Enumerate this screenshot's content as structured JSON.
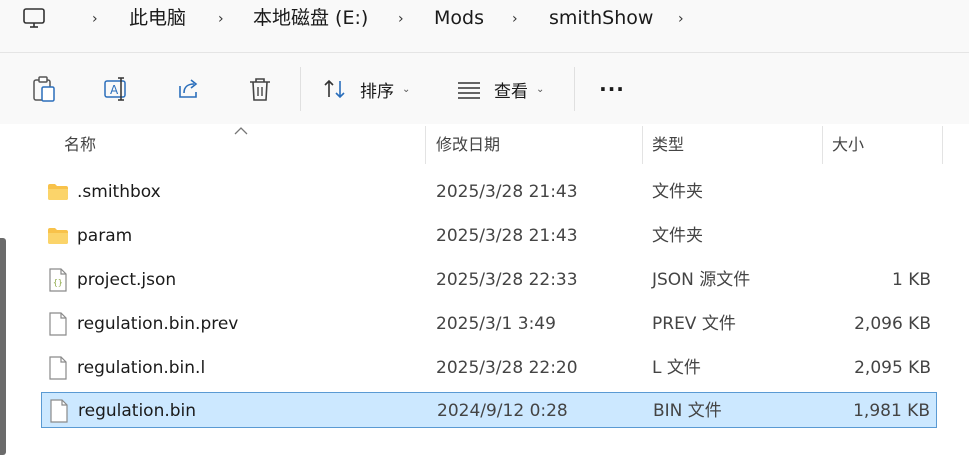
{
  "address": {
    "crumbs": [
      "此电脑",
      "本地磁盘 (E:)",
      "Mods",
      "smithShow"
    ],
    "chevron": "›"
  },
  "toolbar": {
    "sort_label": "排序",
    "view_label": "查看",
    "more_label": "···",
    "caret": "⌄"
  },
  "columns": {
    "name": "名称",
    "date": "修改日期",
    "type": "类型",
    "size": "大小"
  },
  "files": [
    {
      "name": ".smithbox",
      "date": "2025/3/28 21:43",
      "type": "文件夹",
      "size": "",
      "icon": "folder-icon"
    },
    {
      "name": "param",
      "date": "2025/3/28 21:43",
      "type": "文件夹",
      "size": "",
      "icon": "folder-icon"
    },
    {
      "name": "project.json",
      "date": "2025/3/28 22:33",
      "type": "JSON 源文件",
      "size": "1 KB",
      "icon": "json-file-icon"
    },
    {
      "name": "regulation.bin.prev",
      "date": "2025/3/1 3:49",
      "type": "PREV 文件",
      "size": "2,096 KB",
      "icon": "file-icon"
    },
    {
      "name": "regulation.bin.l",
      "date": "2025/3/28 22:20",
      "type": "L 文件",
      "size": "2,095 KB",
      "icon": "file-icon"
    },
    {
      "name": "regulation.bin",
      "date": "2024/9/12 0:28",
      "type": "BIN 文件",
      "size": "1,981 KB",
      "icon": "file-icon",
      "selected": true
    }
  ],
  "colors": {
    "selection_bg": "#cce8ff",
    "selection_border": "#5a9ad3",
    "folder": "#f8c24a"
  }
}
